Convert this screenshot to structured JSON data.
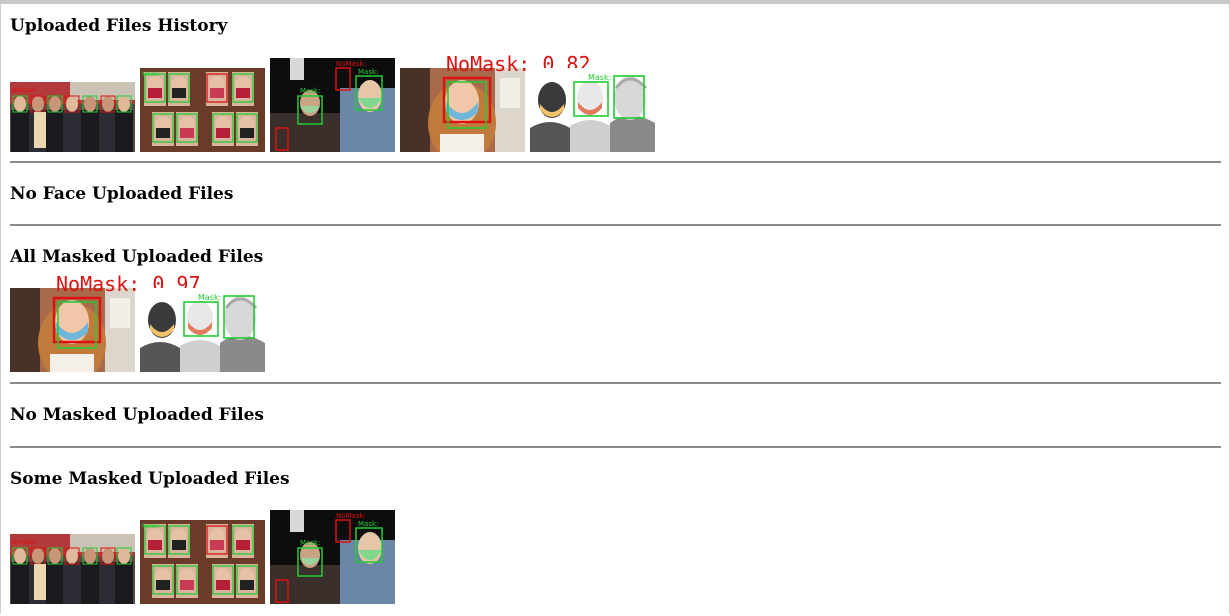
{
  "sections": [
    {
      "title": "Uploaded Files History",
      "images": [
        {
          "scene": "crowd-street",
          "caption": ""
        },
        {
          "scene": "mask-grid",
          "caption": ""
        },
        {
          "scene": "dark-portraits",
          "caption": ""
        },
        {
          "scene": "woman-mask",
          "caption": "NoMask: 0.82"
        },
        {
          "scene": "cartoon-trio",
          "caption": "Mask: 1.0"
        }
      ]
    },
    {
      "title": "No Face Uploaded Files",
      "images": []
    },
    {
      "title": "All Masked Uploaded Files",
      "images": [
        {
          "scene": "woman-mask",
          "caption": "NoMask: 0.97"
        },
        {
          "scene": "cartoon-trio",
          "caption": "Mask: 1.0"
        }
      ]
    },
    {
      "title": "No Masked Uploaded Files",
      "images": []
    },
    {
      "title": "Some Masked Uploaded Files",
      "images": [
        {
          "scene": "crowd-street",
          "caption": ""
        },
        {
          "scene": "mask-grid",
          "caption": ""
        },
        {
          "scene": "dark-portraits",
          "caption": ""
        }
      ]
    }
  ],
  "overlay_labels": {
    "mask": "Mask:",
    "nomask": "NoMask:"
  },
  "colors": {
    "mask_box": "#22cc33",
    "nomask_box": "#dd1111",
    "rule": "#8a8a8a"
  }
}
